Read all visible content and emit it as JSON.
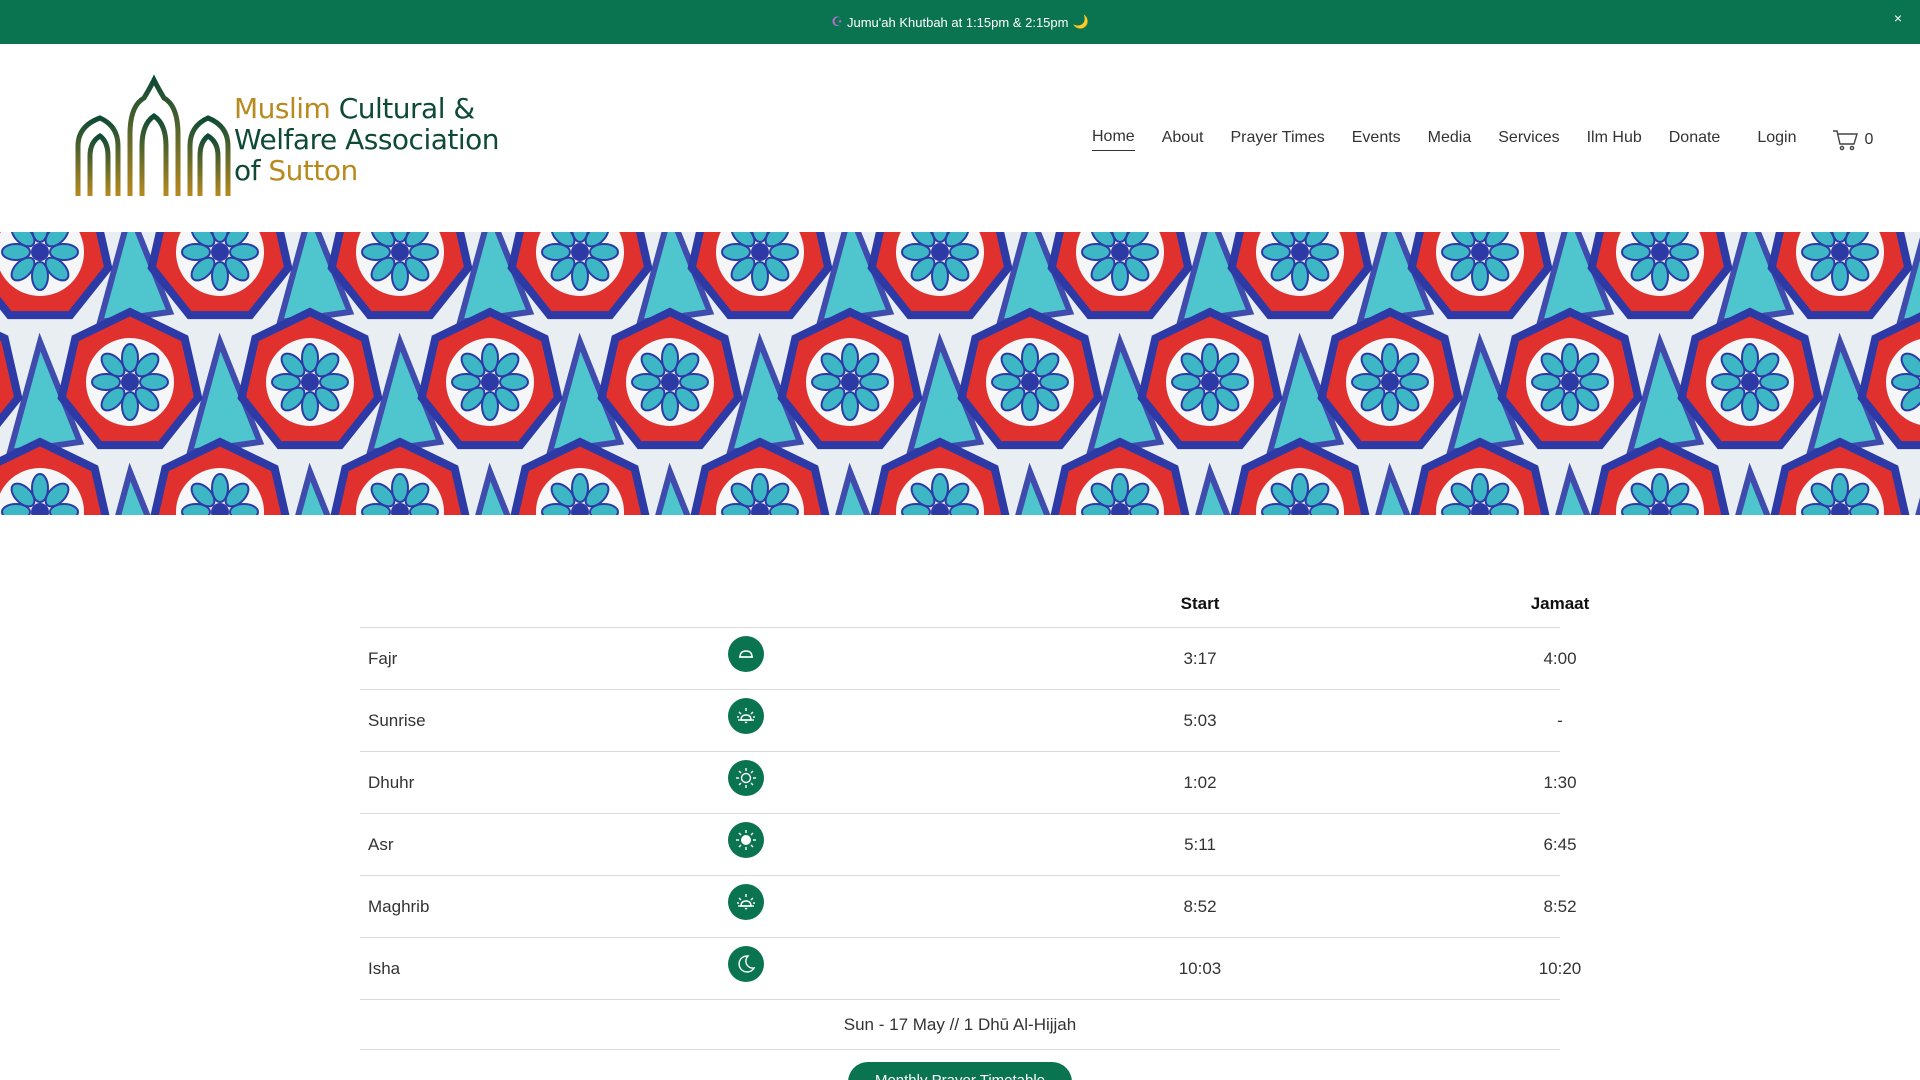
{
  "announcement": {
    "prefix_icon": "crescent-emoji",
    "text": "Jumu'ah Khutbah at 1:15pm & 2:15pm",
    "suffix_icon": "moon-emoji",
    "close_label": "×"
  },
  "logo": {
    "line1_a": "Muslim",
    "line1_b": "Cultural &",
    "line2": "Welfare Association",
    "line3_a": "of",
    "line3_b": "Sutton",
    "colors": {
      "gold": "#b88a1f",
      "green": "#0e4a35"
    }
  },
  "nav": {
    "items": [
      {
        "label": "Home",
        "active": true
      },
      {
        "label": "About"
      },
      {
        "label": "Prayer Times"
      },
      {
        "label": "Events"
      },
      {
        "label": "Media"
      },
      {
        "label": "Services"
      },
      {
        "label": "Ilm Hub"
      },
      {
        "label": "Donate"
      }
    ],
    "login": "Login",
    "cart_count": "0",
    "cart_icon": "cart-icon"
  },
  "prayer_table": {
    "headers": {
      "name": "",
      "icon": "",
      "start": "Start",
      "jamaat": "Jamaat"
    },
    "rows": [
      {
        "name": "Fajr",
        "icon": "dawn-icon",
        "start": "3:17",
        "jamaat": "4:00"
      },
      {
        "name": "Sunrise",
        "icon": "sunrise-icon",
        "start": "5:03",
        "jamaat": "-"
      },
      {
        "name": "Dhuhr",
        "icon": "sun-outline-icon",
        "start": "1:02",
        "jamaat": "1:30"
      },
      {
        "name": "Asr",
        "icon": "sun-solid-icon",
        "start": "5:11",
        "jamaat": "6:45"
      },
      {
        "name": "Maghrib",
        "icon": "sunset-icon",
        "start": "8:52",
        "jamaat": "8:52"
      },
      {
        "name": "Isha",
        "icon": "moon-icon",
        "start": "10:03",
        "jamaat": "10:20"
      }
    ],
    "date_line": "Sun - 17 May // 1 Dhū Al-Hijjah"
  },
  "cta": {
    "label": "Monthly Prayer Timetable"
  },
  "colors": {
    "brand_green": "#0a7450",
    "divider": "#d9d9d9"
  }
}
